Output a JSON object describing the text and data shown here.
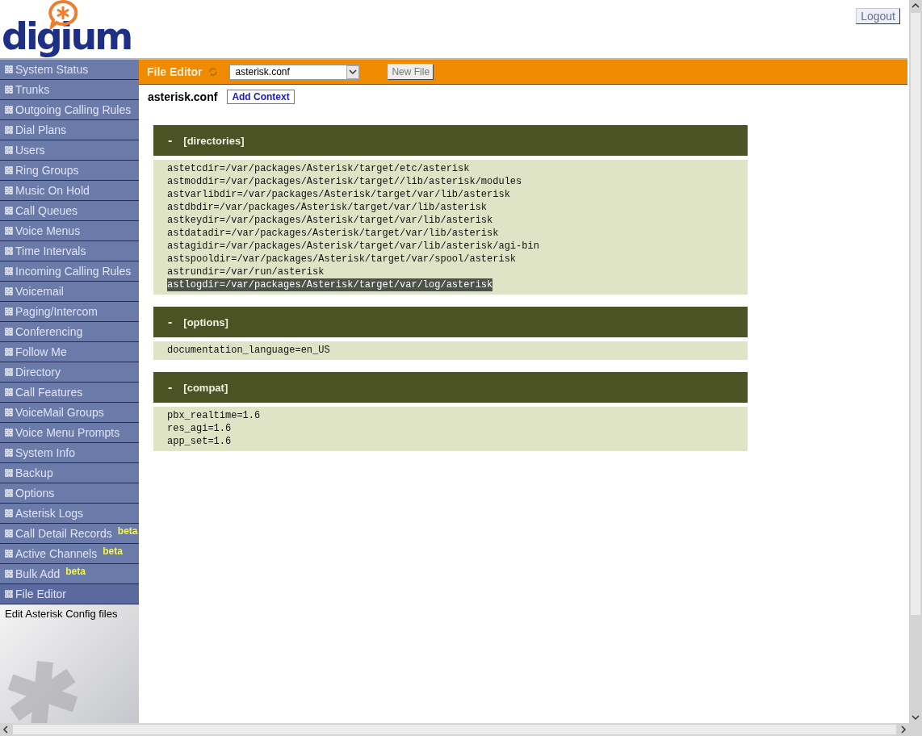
{
  "logo": {
    "text": "digium"
  },
  "logout": "Logout",
  "sidebar": {
    "items": [
      {
        "label": "System Status",
        "selected": false
      },
      {
        "label": "Trunks",
        "selected": false
      },
      {
        "label": "Outgoing Calling Rules",
        "selected": false
      },
      {
        "label": "Dial Plans",
        "selected": false
      },
      {
        "label": "Users",
        "selected": false
      },
      {
        "label": "Ring Groups",
        "selected": false
      },
      {
        "label": "Music On Hold",
        "selected": false
      },
      {
        "label": "Call Queues",
        "selected": false
      },
      {
        "label": "Voice Menus",
        "selected": false
      },
      {
        "label": "Time Intervals",
        "selected": false
      },
      {
        "label": "Incoming Calling Rules",
        "selected": false
      },
      {
        "label": "Voicemail",
        "selected": false
      },
      {
        "label": "Paging/Intercom",
        "selected": false
      },
      {
        "label": "Conferencing",
        "selected": false
      },
      {
        "label": "Follow Me",
        "selected": false
      },
      {
        "label": "Directory",
        "selected": false
      },
      {
        "label": "Call Features",
        "selected": false
      },
      {
        "label": "VoiceMail Groups",
        "selected": false
      },
      {
        "label": "Voice Menu Prompts",
        "selected": false
      },
      {
        "label": "System Info",
        "selected": false
      },
      {
        "label": "Backup",
        "selected": false
      },
      {
        "label": "Options",
        "selected": false
      },
      {
        "label": "Asterisk Logs",
        "selected": false
      },
      {
        "label": "Call Detail Records",
        "badge": "beta",
        "selected": false
      },
      {
        "label": "Active Channels",
        "badge": "beta",
        "selected": false
      },
      {
        "label": "Bulk Add",
        "badge": "beta",
        "selected": false
      },
      {
        "label": "File Editor",
        "selected": true
      }
    ],
    "description": "Edit Asterisk Config files"
  },
  "toolbar": {
    "title": "File Editor",
    "file_select": "asterisk.conf",
    "new_file_button": "New File"
  },
  "file": {
    "name": "asterisk.conf",
    "add_context_button": "Add Context"
  },
  "sections": [
    {
      "toggle": "-",
      "title": "[directories]",
      "lines": [
        {
          "text": "astetcdir=/var/packages/Asterisk/target/etc/asterisk",
          "selected": false
        },
        {
          "text": "astmoddir=/var/packages/Asterisk/target//lib/asterisk/modules",
          "selected": false
        },
        {
          "text": "astvarlibdir=/var/packages/Asterisk/target/var/lib/asterisk",
          "selected": false
        },
        {
          "text": "astdbdir=/var/packages/Asterisk/target/var/lib/asterisk",
          "selected": false
        },
        {
          "text": "astkeydir=/var/packages/Asterisk/target/var/lib/asterisk",
          "selected": false
        },
        {
          "text": "astdatadir=/var/packages/Asterisk/target/var/lib/asterisk",
          "selected": false
        },
        {
          "text": "astagidir=/var/packages/Asterisk/target/var/lib/asterisk/agi-bin",
          "selected": false
        },
        {
          "text": "astspooldir=/var/packages/Asterisk/target/var/spool/asterisk",
          "selected": false
        },
        {
          "text": "astrundir=/var/run/asterisk",
          "selected": false
        },
        {
          "text": "astlogdir=/var/packages/Asterisk/target/var/log/asterisk",
          "selected": true
        }
      ]
    },
    {
      "toggle": "-",
      "title": "[options]",
      "lines": [
        {
          "text": "documentation_language=en_US",
          "selected": false
        }
      ]
    },
    {
      "toggle": "-",
      "title": "[compat]",
      "lines": [
        {
          "text": "pbx_realtime=1.6",
          "selected": false
        },
        {
          "text": "res_agi=1.6",
          "selected": false
        },
        {
          "text": "app_set=1.6",
          "selected": false
        }
      ]
    }
  ]
}
